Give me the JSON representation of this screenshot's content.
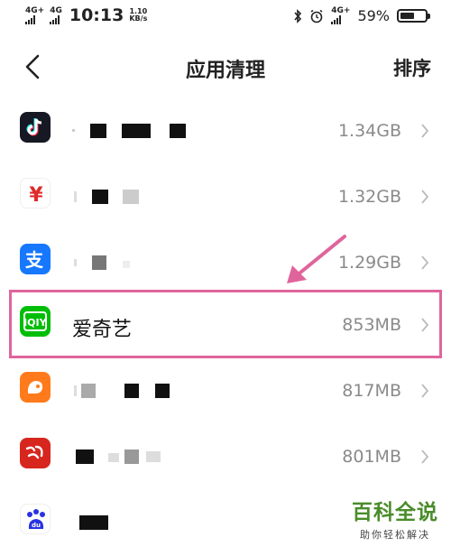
{
  "status_bar": {
    "signal1_label": "4G+",
    "signal2_label": "4G",
    "time": "10:13",
    "net_speed_value": "1.10",
    "net_speed_unit": "KB/s",
    "signal3_label": "4G+",
    "battery_text": "59%",
    "battery_level": 0.59
  },
  "header": {
    "title": "应用清理",
    "sort_label": "排序"
  },
  "apps": [
    {
      "name": "",
      "size": "1.34GB",
      "icon": "tiktok-icon"
    },
    {
      "name": "",
      "size": "1.32GB",
      "icon": "yuan-icon"
    },
    {
      "name": "",
      "size": "1.29GB",
      "icon": "alipay-icon"
    },
    {
      "name": "爱奇艺",
      "size": "853MB",
      "icon": "iqiyi-icon"
    },
    {
      "name": "",
      "size": "817MB",
      "icon": "squirrel-icon"
    },
    {
      "name": "",
      "size": "801MB",
      "icon": "xuexi-icon"
    },
    {
      "name": "",
      "size": "",
      "icon": "baidu-icon"
    }
  ],
  "watermark": {
    "title": "百科全说",
    "subtitle": "助你轻松解决"
  },
  "colors": {
    "highlight": "#e0649c",
    "size_text": "#8a8a8a",
    "watermark_green": "#4a8c2a"
  }
}
